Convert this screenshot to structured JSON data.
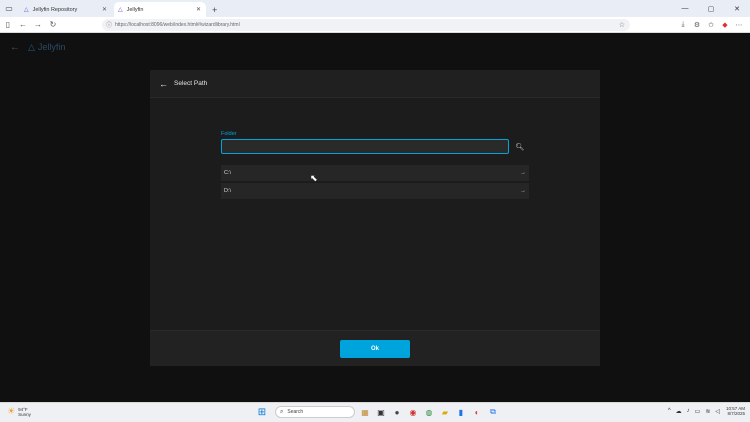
{
  "browser": {
    "tabs": [
      {
        "label": "Jellyfin Repository",
        "active": false
      },
      {
        "label": "Jellyfin",
        "active": true
      }
    ],
    "url": "https://localhost:8096/web/index.html#/wizardlibrary.html"
  },
  "app": {
    "title": "Jellyfin"
  },
  "dialog": {
    "title": "Select Path",
    "folder_label": "Folder",
    "folder_value": "",
    "directories": [
      {
        "label": "C:\\"
      },
      {
        "label": "D:\\"
      }
    ],
    "ok_label": "Ok"
  },
  "taskbar": {
    "weather_temp": "94°F",
    "weather_desc": "Sunny",
    "search_placeholder": "Search",
    "time": "10:57 AM",
    "date": "8/7/2025"
  },
  "colors": {
    "accent": "#00a4dc",
    "dialog_bg": "#1c1c1c",
    "page_bg": "#101010"
  },
  "icons": [
    "window-icon",
    "tab-jellyfin-icon",
    "close-icon",
    "new-tab-icon",
    "minimize-icon",
    "maximize-icon",
    "back-icon",
    "forward-icon",
    "refresh-icon",
    "info-icon",
    "star-icon",
    "download-icon",
    "extension-icon",
    "arrow-left-icon",
    "jellyfin-logo-icon",
    "search-icon",
    "chevron-right-icon",
    "start-icon",
    "sun-icon"
  ]
}
